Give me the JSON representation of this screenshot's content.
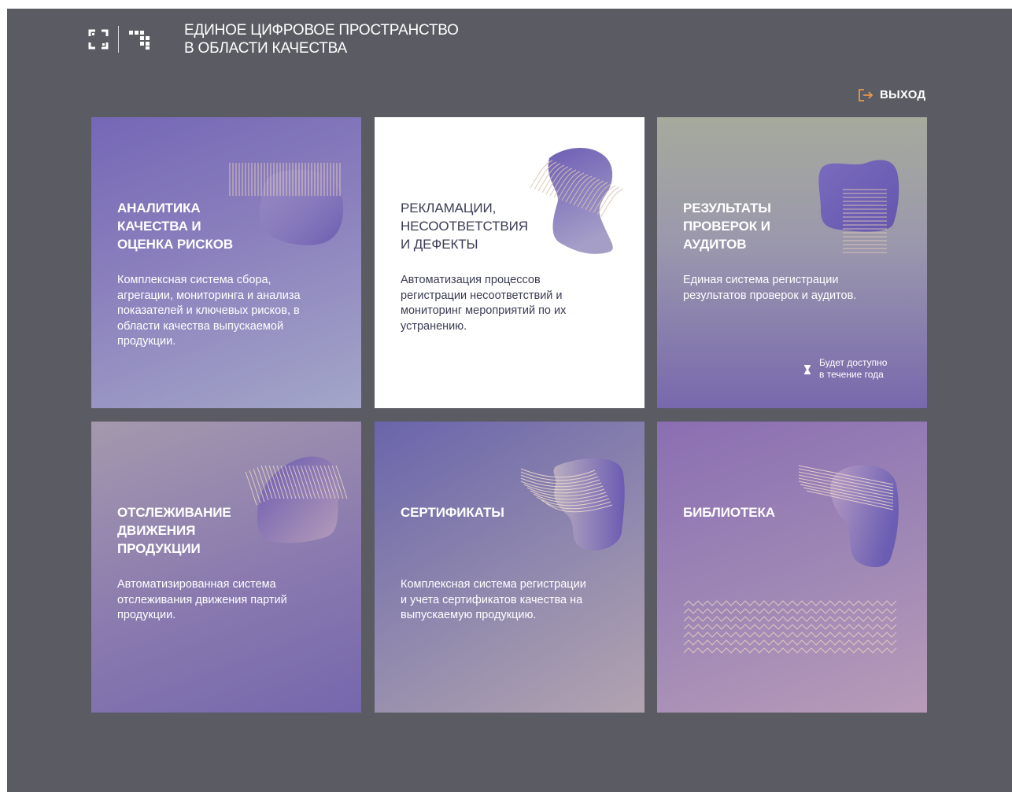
{
  "header": {
    "title_line1": "ЕДИНОЕ ЦИФРОВОЕ ПРОСТРАНСТВО",
    "title_line2": "В ОБЛАСТИ КАЧЕСТВА"
  },
  "logout": {
    "label": "ВЫХОД",
    "icon": "logout-icon"
  },
  "colors": {
    "background": "#5b5b64",
    "accent": "#e69a4b",
    "text_dark": "#3b3c55"
  },
  "cards": [
    {
      "title": [
        "АНАЛИТИКА",
        "КАЧЕСТВА И",
        "ОЦЕНКА РИСКОВ"
      ],
      "description": [
        "Комплексная система сбора,",
        "агрегации, мониторинга и анализа",
        "показателей и ключевых рисков, в",
        "области качества выпускаемой",
        "продукции."
      ]
    },
    {
      "title": [
        "РЕКЛАМАЦИИ,",
        "НЕСООТВЕТСТВИЯ",
        "И ДЕФЕКТЫ"
      ],
      "description": [
        "Автоматизация процессов",
        "регистрации несоответствий и",
        "мониторинг мероприятий по их",
        "устранению."
      ]
    },
    {
      "title": [
        "РЕЗУЛЬТАТЫ",
        "ПРОВЕРОК И",
        "АУДИТОВ"
      ],
      "description": [
        "Единая система регистрации",
        "результатов проверок и аудитов."
      ],
      "badge": [
        "Будет доступно",
        "в течение года"
      ],
      "badge_icon": "hourglass-icon"
    },
    {
      "title": [
        "ОТСЛЕЖИВАНИЕ",
        "ДВИЖЕНИЯ",
        "ПРОДУКЦИИ"
      ],
      "description": [
        "Автоматизированная система",
        "отслеживания движения партий",
        "продукции."
      ]
    },
    {
      "title": [
        "СЕРТИФИКАТЫ"
      ],
      "description": [
        "Комплексная система регистрации",
        "и учета сертификатов качества на",
        "выпускаемую продукцию."
      ]
    },
    {
      "title": [
        "БИБЛИОТЕКА"
      ]
    }
  ]
}
